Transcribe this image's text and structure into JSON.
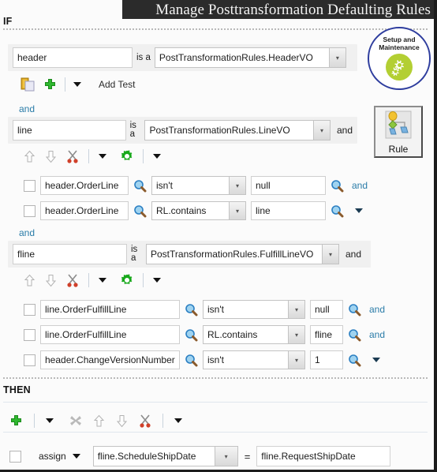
{
  "window": {
    "title": "Manage Posttransformation Defaulting Rules"
  },
  "sections": {
    "if_label": "IF",
    "then_label": "THEN"
  },
  "side_panel": {
    "setup_badge": {
      "line1": "Setup and",
      "line2": "Maintenance",
      "icon": "gears-icon"
    },
    "rule_button": {
      "label": "Rule",
      "icon": "rule-diagram-icon"
    }
  },
  "if_section": {
    "fact_header": {
      "variable": "header",
      "is_a_label": "is a",
      "type": "PostTransformationRules.HeaderVO"
    },
    "header_toolbar": {
      "copy_icon": "copy-paste-icon",
      "add_icon": "plus-icon",
      "dropdown_icon": "caret-down-icon",
      "add_test_label": "Add Test"
    },
    "connector_1": "and",
    "fact_line": {
      "variable": "line",
      "is_a_label": "is a",
      "type": "PostTransformationRules.LineVO",
      "trailing": "and"
    },
    "line_toolbar": {
      "up_icon": "arrow-up-icon",
      "down_icon": "arrow-down-icon",
      "cut_icon": "scissors-icon",
      "cut_dropdown_icon": "caret-down-icon",
      "gear_icon": "gear-icon",
      "gear_dropdown_icon": "caret-down-icon"
    },
    "line_tests": [
      {
        "checked": false,
        "left": "header.OrderLine",
        "left_search_icon": "magnifier-icon",
        "operator": "isn't",
        "right": "null",
        "right_search_icon": "magnifier-icon",
        "connector": "and",
        "connector_type": "link"
      },
      {
        "checked": false,
        "left": "header.OrderLine",
        "left_search_icon": "magnifier-icon",
        "operator": "RL.contains",
        "right": "line",
        "right_search_icon": "magnifier-icon",
        "connector": "",
        "connector_type": "caret"
      }
    ],
    "connector_2": "and",
    "fact_fline": {
      "variable": "fline",
      "is_a_label": "is a",
      "type": "PostTransformationRules.FulfillLineVO",
      "trailing": "and"
    },
    "fline_toolbar": {
      "up_icon": "arrow-up-icon",
      "down_icon": "arrow-down-icon",
      "cut_icon": "scissors-icon",
      "cut_dropdown_icon": "caret-down-icon",
      "gear_icon": "gear-icon",
      "gear_dropdown_icon": "caret-down-icon"
    },
    "fline_tests": [
      {
        "checked": false,
        "left": "line.OrderFulfillLine",
        "left_search_icon": "magnifier-icon",
        "operator": "isn't",
        "right": "null",
        "right_search_icon": "magnifier-icon",
        "connector": "and",
        "connector_type": "link"
      },
      {
        "checked": false,
        "left": "line.OrderFulfillLine",
        "left_search_icon": "magnifier-icon",
        "operator": "RL.contains",
        "right": "fline",
        "right_search_icon": "magnifier-icon",
        "connector": "and",
        "connector_type": "link"
      },
      {
        "checked": false,
        "left": "header.ChangeVersionNumber",
        "left_search_icon": "magnifier-icon",
        "operator": "isn't",
        "right": "1",
        "right_search_icon": "magnifier-icon",
        "connector": "",
        "connector_type": "caret"
      }
    ]
  },
  "then_section": {
    "toolbar": {
      "add_icon": "plus-icon",
      "add_dropdown_icon": "caret-down-icon",
      "delete_icon": "x-delete-icon",
      "up_icon": "arrow-up-icon",
      "down_icon": "arrow-down-icon",
      "cut_icon": "scissors-icon",
      "cut_dropdown_icon": "caret-down-icon"
    },
    "action": {
      "checked": false,
      "action_label": "assign",
      "action_caret_icon": "caret-down-icon",
      "target": "fline.ScheduleShipDate",
      "target_dropdown_icon": "caret-down-icon",
      "equals": "=",
      "value": "fline.RequestShipDate"
    }
  },
  "colors": {
    "titlebar_bg": "#2b2b2b",
    "link": "#2a7ca8",
    "badge_border": "#2e3d9e",
    "badge_circle": "#b3cf33",
    "plus_green": "#2fb72f",
    "gear_green": "#17a81a",
    "scissors_red": "#d0402a"
  }
}
